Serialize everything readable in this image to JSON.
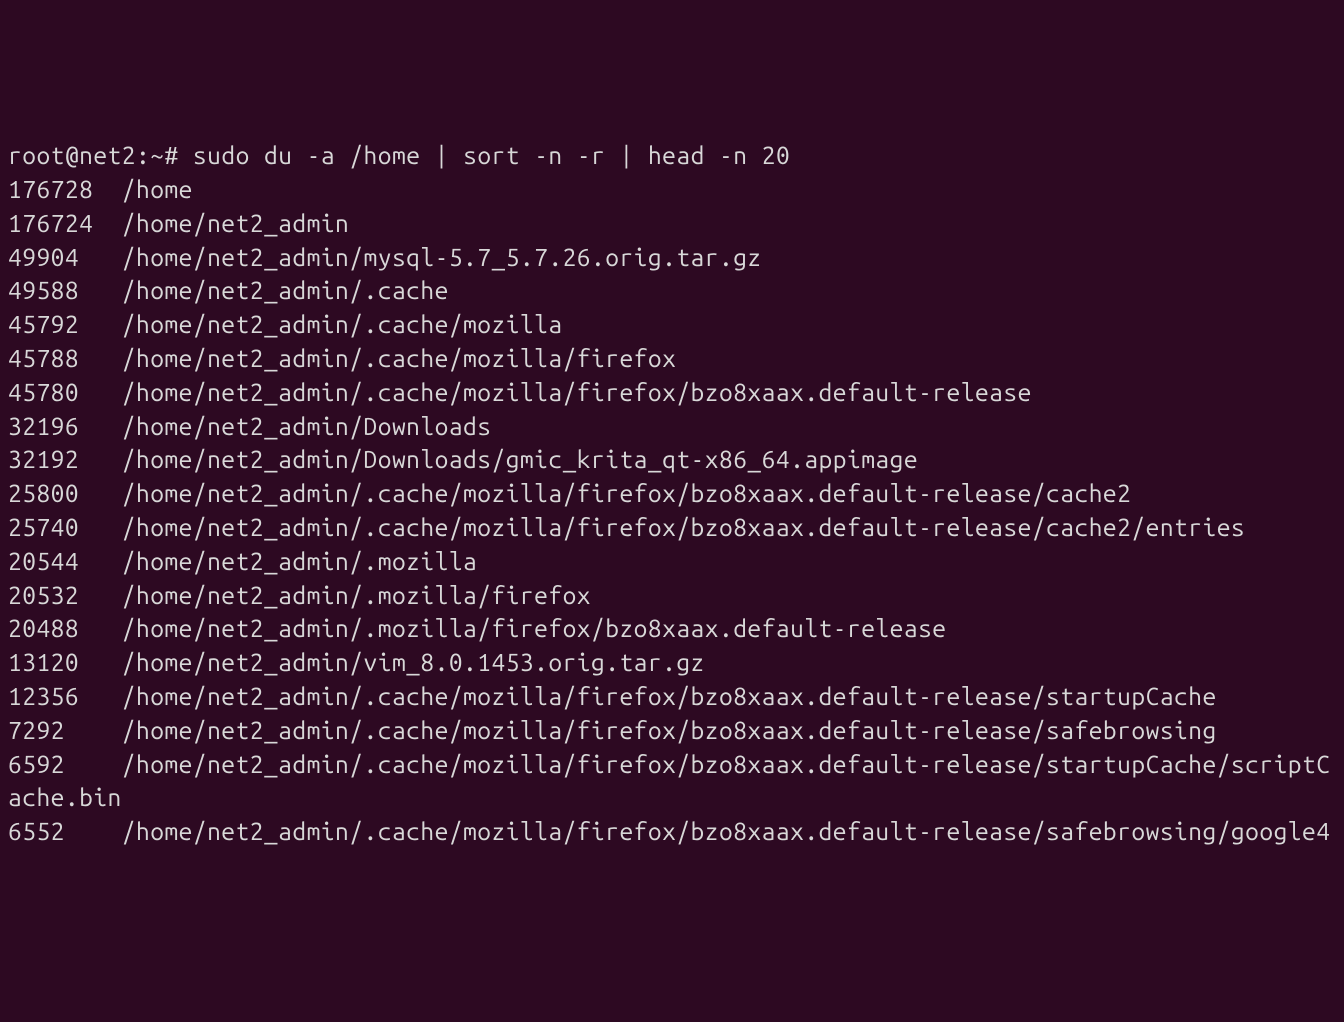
{
  "prompt": {
    "user_host": "root@net2",
    "separator": ":",
    "cwd": "~",
    "symbol": "#",
    "command": "sudo du -a /home | sort -n -r | head -n 20"
  },
  "size_col_width": 8,
  "lines": [
    {
      "size": "176728",
      "path": "/home"
    },
    {
      "size": "176724",
      "path": "/home/net2_admin"
    },
    {
      "size": "49904",
      "path": "/home/net2_admin/mysql-5.7_5.7.26.orig.tar.gz"
    },
    {
      "size": "49588",
      "path": "/home/net2_admin/.cache"
    },
    {
      "size": "45792",
      "path": "/home/net2_admin/.cache/mozilla"
    },
    {
      "size": "45788",
      "path": "/home/net2_admin/.cache/mozilla/firefox"
    },
    {
      "size": "45780",
      "path": "/home/net2_admin/.cache/mozilla/firefox/bzo8xaax.default-release"
    },
    {
      "size": "32196",
      "path": "/home/net2_admin/Downloads"
    },
    {
      "size": "32192",
      "path": "/home/net2_admin/Downloads/gmic_krita_qt-x86_64.appimage"
    },
    {
      "size": "25800",
      "path": "/home/net2_admin/.cache/mozilla/firefox/bzo8xaax.default-release/cache2"
    },
    {
      "size": "25740",
      "path": "/home/net2_admin/.cache/mozilla/firefox/bzo8xaax.default-release/cache2/entries"
    },
    {
      "size": "20544",
      "path": "/home/net2_admin/.mozilla"
    },
    {
      "size": "20532",
      "path": "/home/net2_admin/.mozilla/firefox"
    },
    {
      "size": "20488",
      "path": "/home/net2_admin/.mozilla/firefox/bzo8xaax.default-release"
    },
    {
      "size": "13120",
      "path": "/home/net2_admin/vim_8.0.1453.orig.tar.gz"
    },
    {
      "size": "12356",
      "path": "/home/net2_admin/.cache/mozilla/firefox/bzo8xaax.default-release/startupCache"
    },
    {
      "size": "7292",
      "path": "/home/net2_admin/.cache/mozilla/firefox/bzo8xaax.default-release/safebrowsing"
    },
    {
      "size": "6592",
      "path": "/home/net2_admin/.cache/mozilla/firefox/bzo8xaax.default-release/startupCache/scriptCache.bin"
    },
    {
      "size": "6552",
      "path": "/home/net2_admin/.cache/mozilla/firefox/bzo8xaax.default-release/safebrowsing/google4"
    }
  ]
}
